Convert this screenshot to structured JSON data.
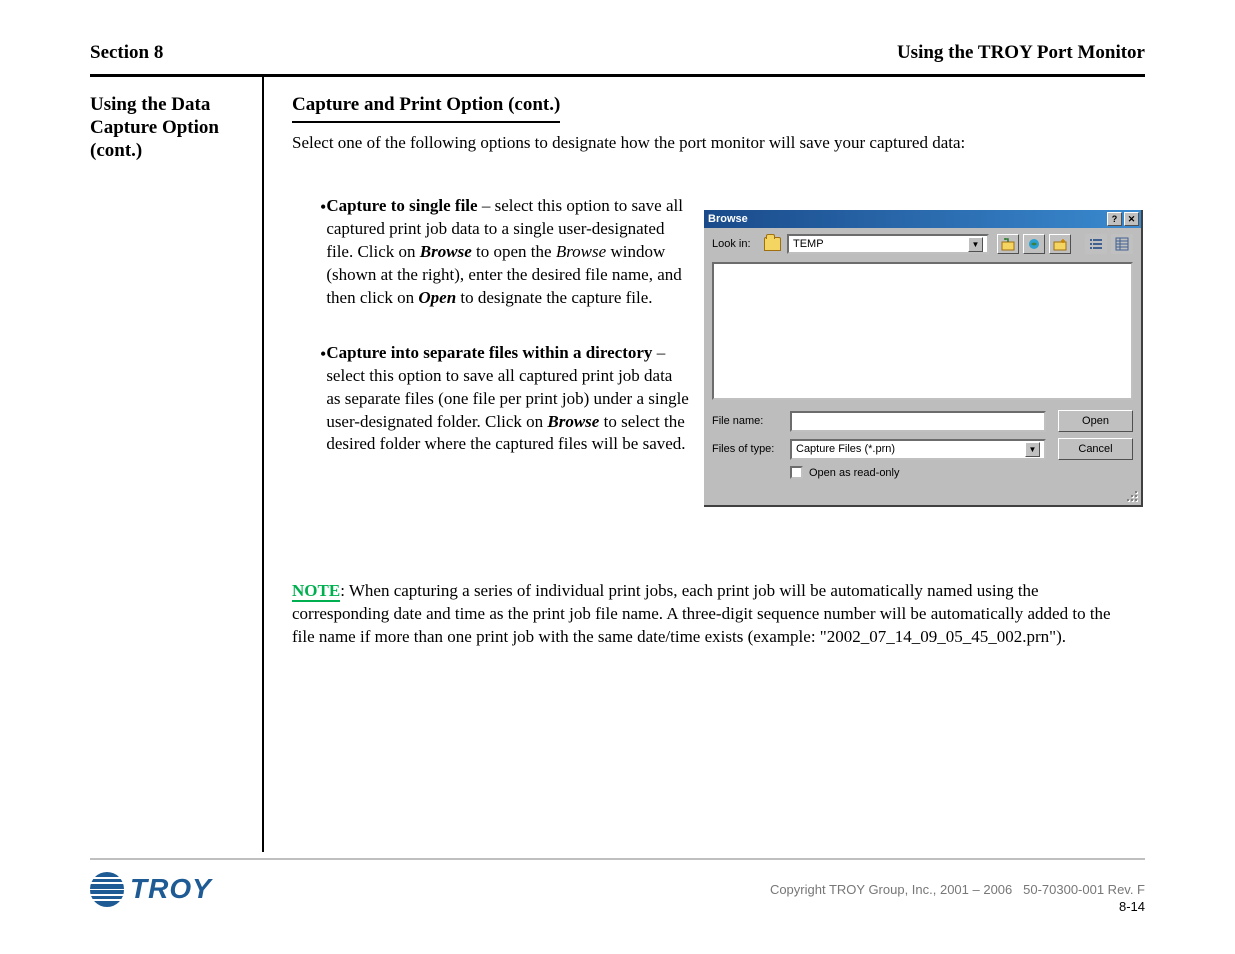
{
  "header": {
    "left": "Section 8",
    "right": "Using the TROY Port Monitor"
  },
  "sidebar": "Using the Data Capture Option (cont.)",
  "section_title": "Capture and Print Option (cont.)",
  "intro": "Select one of the following options to designate how the port monitor will save your captured data:",
  "bullets": [
    {
      "label": "Capture to single file",
      "text": " – select this option to save all captured print job data to a single user-designated file. Click on ",
      "btn": "Browse",
      "text2": " to open the ",
      "ital": "Browse",
      "text3": " window (shown at the right), enter the desired file name, and then click on ",
      "btn2": "Open",
      "text4": " to designate the capture file."
    },
    {
      "label": "Capture into separate files within a directory",
      "text": " – select this option to save all captured print job data as separate files (one file per print job) under a single user-designated folder. Click on ",
      "btn": "Browse",
      "text2": " to select the desired folder where the captured files will be saved."
    }
  ],
  "note_label": "NOTE",
  "note_text": ": When capturing a series of individual print jobs, each print job will be automatically named using the corresponding date and time as the print job file name. A three-digit sequence number will be automatically added to the file name if more than one print job with the same date/time exists (example: \"2002_07_14_09_05_45_002.prn\").",
  "dialog": {
    "title": "Browse",
    "help": "?",
    "close": "✕",
    "lookin_label": "Look in:",
    "folder_name": "TEMP",
    "filename_label": "File name:",
    "filename_value": "",
    "type_label": "Files of type:",
    "type_value": "Capture Files (*.prn)",
    "open_btn": "Open",
    "cancel_btn": "Cancel",
    "readonly": "Open as read-only"
  },
  "footer": {
    "copyright": "Copyright TROY Group, Inc., 2001 – 2006",
    "docref": "50-70300-001 Rev. F",
    "page": "8-14"
  }
}
